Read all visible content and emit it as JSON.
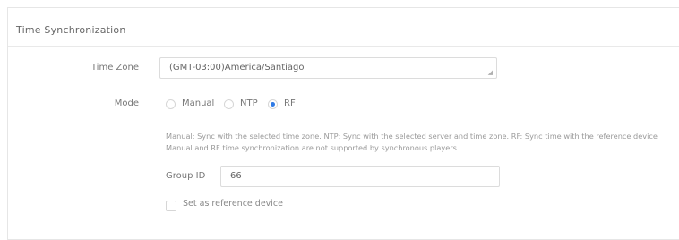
{
  "section": {
    "title": "Time Synchronization"
  },
  "time_zone": {
    "label": "Time Zone",
    "value": "(GMT-03:00)America/Santiago"
  },
  "mode": {
    "label": "Mode",
    "options": [
      {
        "label": "Manual",
        "checked": false
      },
      {
        "label": "NTP",
        "checked": false
      },
      {
        "label": "RF",
        "checked": true
      }
    ],
    "help_line_1": "Manual: Sync with the selected time zone. NTP: Sync with the selected server and time zone. RF: Sync time with the reference device",
    "help_line_2": "Manual and RF time synchronization are not supported by synchronous players."
  },
  "group_id": {
    "label": "Group ID",
    "value": "66"
  },
  "reference_device": {
    "label": "Set as reference device",
    "checked": false
  },
  "colors": {
    "accent": "#2f7ae5",
    "border": "#dcdcdc"
  }
}
